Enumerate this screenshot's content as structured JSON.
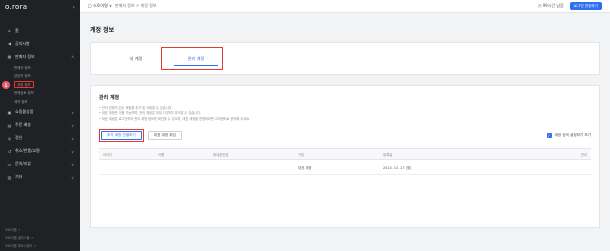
{
  "sidebar": {
    "logo": "o.rora",
    "items": [
      {
        "label": "홈",
        "icon": "home-icon"
      },
      {
        "label": "공지사항",
        "icon": "megaphone-icon"
      },
      {
        "label": "판매자 정보",
        "icon": "store-icon"
      },
      {
        "label": "쇼핑몰상품",
        "icon": "box-icon"
      },
      {
        "label": "주문 배송",
        "icon": "cart-icon"
      },
      {
        "label": "정산",
        "icon": "coin-icon"
      },
      {
        "label": "취소/반품/교환",
        "icon": "return-icon"
      },
      {
        "label": "문의/리뷰",
        "icon": "chat-icon"
      },
      {
        "label": "기타",
        "icon": "etc-icon"
      }
    ],
    "subitems": [
      {
        "label": "판매자 정보"
      },
      {
        "label": "담당자 정보"
      },
      {
        "label": "계정 정보"
      },
      {
        "label": "판매검토 정보"
      },
      {
        "label": "계약 정보"
      }
    ],
    "bottom_links": [
      "오로라몰 ↗",
      "오로라몰 셀러스쿨 ↗",
      "오로라몰 파트너센터 ↗"
    ]
  },
  "topbar": {
    "store": "□ 스토어명 ∨",
    "breadcrumb": "판매자 정보 > 계정 정보",
    "remain": "◷ 99시간 남음",
    "upgrade_label": "로그인 연장하기"
  },
  "page": {
    "title": "계정 정보",
    "tabs": [
      "내 계정",
      "관리 계정"
    ]
  },
  "section": {
    "title": "관리 계정",
    "notes": [
      "• 관리 권한이 있는 계정을 추가 및 삭제할 수 있습니다.",
      "• 대표 계정만 이용 가능하며, 관리 계정은 최대 1개까지 추가할 수 있습니다.",
      "• 대표 계정은 로그인하여 관리 계정 정보를 확인할 수 있으며, 대표 계정을 변경하려면 고객센터로 문의해 주세요."
    ],
    "add_button": "추가 계정 연결하기",
    "transfer_button": "대표 계정 위임",
    "checkbox_label": "계정 검색 설정하기 보기",
    "columns": [
      "아이디",
      "이름",
      "휴대폰번호",
      "구분",
      "등록일",
      "관리"
    ],
    "rows": [
      {
        "id": "",
        "name": "",
        "phone": "",
        "type": "대표 계정",
        "date": "2023. 10. 27 (월)",
        "manage": ""
      }
    ]
  },
  "markers": [
    "1",
    "2",
    "3"
  ],
  "colors": {
    "accent": "#2f6ff2",
    "highlight": "#e53935",
    "sidebar": "#1f2124"
  }
}
